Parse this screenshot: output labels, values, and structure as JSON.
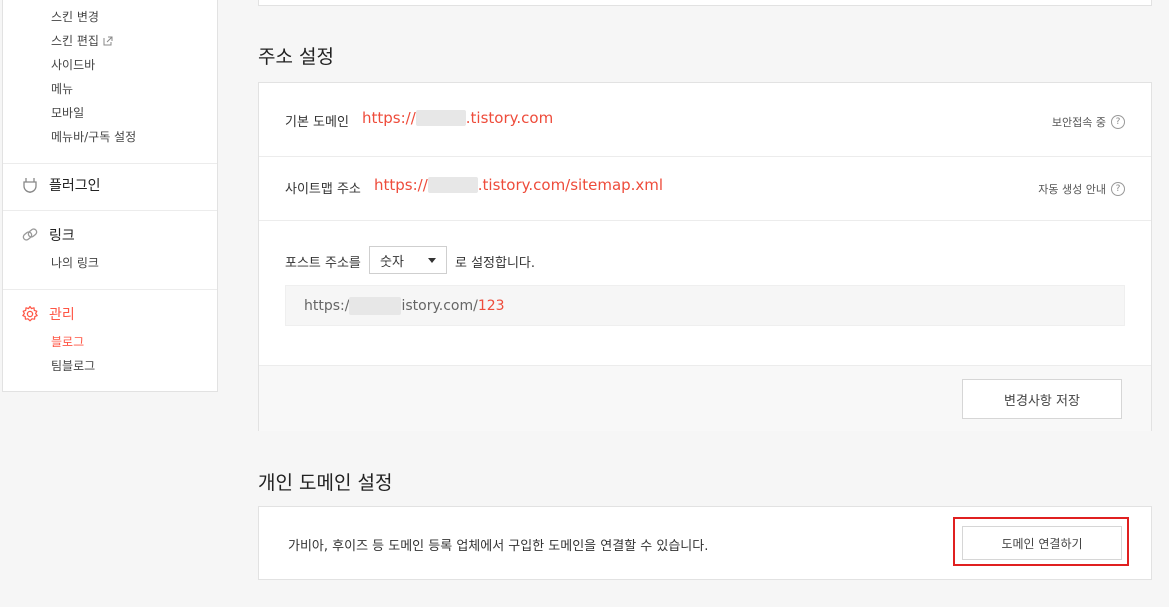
{
  "sidebar": {
    "skin_items": [
      "스킨 변경",
      "스킨 편집",
      "사이드바",
      "메뉴",
      "모바일",
      "메뉴바/구독 설정"
    ],
    "plugin_label": "플러그인",
    "link_label": "링크",
    "link_items": [
      "나의 링크"
    ],
    "manage_label": "관리",
    "manage_items": [
      "블로그",
      "팀블로그"
    ]
  },
  "address": {
    "title": "주소 설정",
    "default_domain_label": "기본 도메인",
    "default_domain_prefix": "https://",
    "default_domain_suffix": ".tistory.com",
    "secure_label": "보안접속 중",
    "sitemap_label": "사이트맵 주소",
    "sitemap_prefix": "https://",
    "sitemap_suffix": ".tistory.com/sitemap.xml",
    "sitemap_info": "자동 생성 안내",
    "post_label": "포스트 주소를",
    "post_select": "숫자",
    "post_suffix": "로 설정합니다.",
    "preview_prefix": "https:/",
    "preview_suffix": "istory.com/",
    "preview_num": "123",
    "save_button": "변경사항 저장"
  },
  "custom_domain": {
    "title": "개인 도메인 설정",
    "description": "가비아, 후이즈 등 도메인 등록 업체에서 구입한 도메인을 연결할 수 있습니다.",
    "connect_button": "도메인 연결하기"
  },
  "colors": {
    "accent": "#ee4c3b",
    "highlight": "#e02020"
  },
  "icons": {
    "external": "external-link-icon",
    "plugin": "plugin-icon",
    "link": "link-icon",
    "manage": "gear-icon",
    "help": "question-icon"
  }
}
